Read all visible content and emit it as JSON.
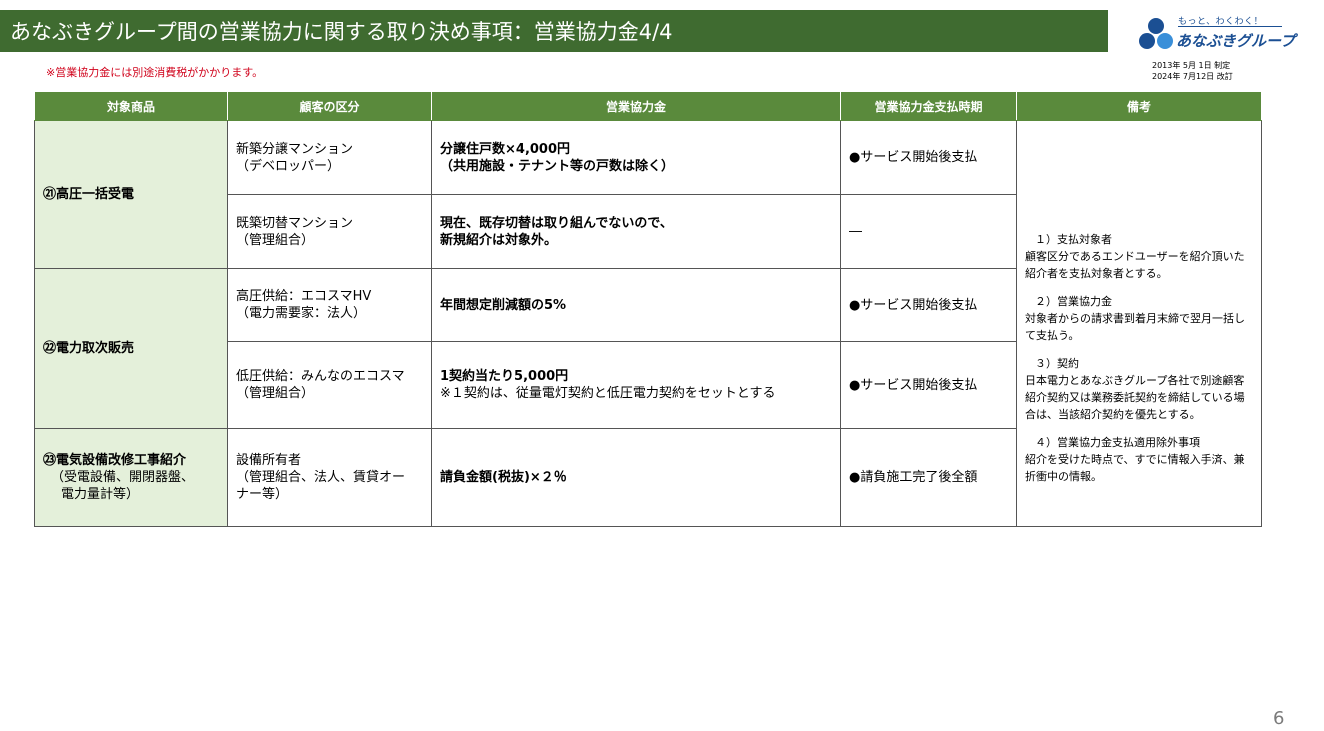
{
  "header": {
    "title": "あなぶきグループ間の営業協力に関する取り決め事項：営業協力金4/4"
  },
  "logo": {
    "tagline": "もっと、わくわく！",
    "name": "あなぶきグループ",
    "brand_color": "#1b4f93"
  },
  "dates": {
    "established": "2013年 5月 1日 制定",
    "revised": "2024年 7月12日 改訂"
  },
  "note": "※営業協力金には別途消費税がかかります。",
  "table": {
    "headers": [
      "対象商品",
      "顧客の区分",
      "営業協力金",
      "営業協力金支払時期",
      "備考"
    ],
    "groups": [
      {
        "product": "㉑高圧一括受電",
        "product_sub": [],
        "rows": [
          {
            "customer": [
              "新築分譲マンション",
              "（デベロッパー）"
            ],
            "fee": [
              "分譲住戸数×4,000円",
              "（共用施設・テナント等の戸数は除く）"
            ],
            "fee_note": "",
            "timing": "●サービス開始後支払"
          },
          {
            "customer": [
              "既築切替マンション",
              "（管理組合）"
            ],
            "fee": [
              "現在、既存切替は取り組んでないので、",
              "新規紹介は対象外。"
            ],
            "fee_note": "",
            "timing": "―"
          }
        ]
      },
      {
        "product": "㉒電力取次販売",
        "product_sub": [],
        "rows": [
          {
            "customer": [
              "高圧供給：エコスマHV",
              "（電力需要家：法人）"
            ],
            "fee": [
              "年間想定削減額の5%"
            ],
            "fee_note": "",
            "timing": "●サービス開始後支払"
          },
          {
            "customer": [
              "低圧供給：みんなのエコスマ",
              "（管理組合）"
            ],
            "fee": [
              "1契約当たり5,000円"
            ],
            "fee_note": "※１契約は、従量電灯契約と低圧電力契約をセットとする",
            "timing": "●サービス開始後支払"
          }
        ]
      },
      {
        "product": "㉓電気設備改修工事紹介",
        "product_sub": [
          "（受電設備、開閉器盤、",
          "電力量計等）"
        ],
        "rows": [
          {
            "customer": [
              "設備所有者",
              "（管理組合、法人、賃貸オー",
              "ナー等）"
            ],
            "fee": [
              "請負金額(税抜)×２％"
            ],
            "fee_note": "",
            "timing": "●請負施工完了後全額"
          }
        ]
      }
    ],
    "remarks": [
      {
        "heading": "１）支払対象者",
        "body": "顧客区分であるエンドユーザーを紹介頂いた紹介者を支払対象者とする。"
      },
      {
        "heading": "２）営業協力金",
        "body": "対象者からの請求書到着月末締で翌月一括して支払う。"
      },
      {
        "heading": "３）契約",
        "body": "日本電力とあなぶきグループ各社で別途顧客紹介契約又は業務委託契約を締結している場合は、当該紹介契約を優先とする。"
      },
      {
        "heading": "４）営業協力金支払適用除外事項",
        "body": "紹介を受けた時点で、すでに情報入手済、兼折衝中の情報。"
      }
    ]
  },
  "page_number": "6",
  "colors": {
    "title_bar": "#3f6b30",
    "header_row": "#5a8a3c",
    "product_cell": "#e4f0da",
    "note_text": "#d0021b"
  }
}
